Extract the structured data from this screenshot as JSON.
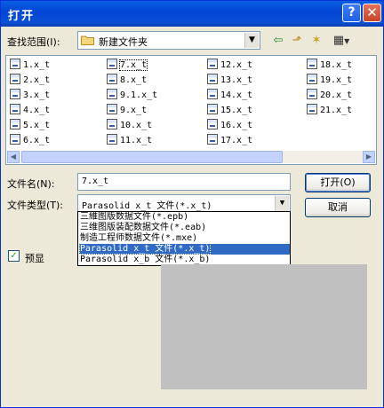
{
  "window": {
    "title": "打开",
    "help_glyph": "?",
    "close_glyph": "✕"
  },
  "lookin": {
    "label": "查找范围(I):",
    "value": "新建文件夹"
  },
  "files": [
    {
      "name": "1.x_t"
    },
    {
      "name": "2.x_t"
    },
    {
      "name": "3.x_t"
    },
    {
      "name": "4.x_t"
    },
    {
      "name": "5.x_t"
    },
    {
      "name": "6.x_t"
    },
    {
      "name": "7.x_t",
      "selected": true
    },
    {
      "name": "8.x_t"
    },
    {
      "name": "9.1.x_t"
    },
    {
      "name": "9.x_t"
    },
    {
      "name": "10.x_t"
    },
    {
      "name": "11.x_t"
    },
    {
      "name": "12.x_t"
    },
    {
      "name": "13.x_t"
    },
    {
      "name": "14.x_t"
    },
    {
      "name": "15.x_t"
    },
    {
      "name": "16.x_t"
    },
    {
      "name": "17.x_t"
    },
    {
      "name": "18.x_t"
    },
    {
      "name": "19.x_t"
    },
    {
      "name": "20.x_t"
    },
    {
      "name": "21.x_t"
    }
  ],
  "filename": {
    "label": "文件名(N):",
    "value": "7.x_t"
  },
  "filetype": {
    "label": "文件类型(T):",
    "value": "Parasolid x_t 文件(*.x_t)",
    "options": [
      "三維图版数据文件(*.epb)",
      "三维图版装配数据文件(*.eab)",
      "制造工程师数据文件(*.mxe)",
      "Parasolid x_t 文件(*.x_t)",
      "Parasolid x_b 文件(*.x_b)"
    ],
    "selected_index": 3
  },
  "buttons": {
    "open": "打开(O)",
    "cancel": "取消"
  },
  "preview": {
    "label": "预显",
    "checked": true,
    "check_glyph": "✓"
  },
  "icons": {
    "arrow": "▼",
    "back": "⇦",
    "up": "⬏",
    "newfolder": "✶",
    "view": "▦",
    "left": "◀",
    "right": "▶"
  }
}
